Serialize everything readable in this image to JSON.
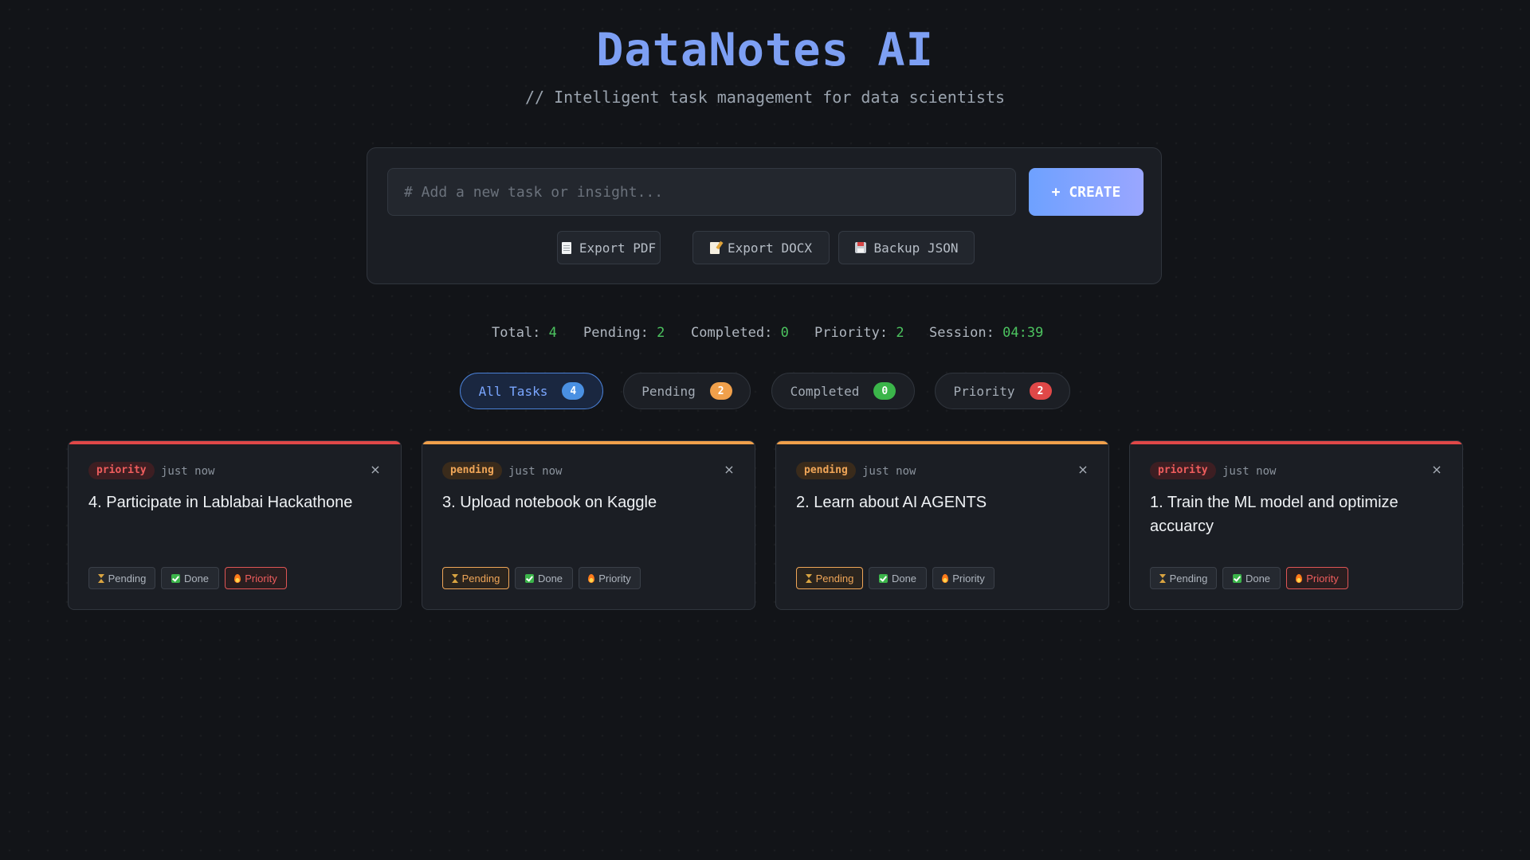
{
  "header": {
    "title": "DataNotes AI",
    "subtitle": "// Intelligent task management for data scientists"
  },
  "composer": {
    "input_value": "",
    "input_placeholder": "# Add a new task or insight...",
    "create_label": "+ CREATE",
    "export_pdf_label": "Export PDF",
    "export_docx_label": "Export DOCX",
    "backup_json_label": "Backup JSON"
  },
  "stats": {
    "total_label": "Total:",
    "total_value": "4",
    "pending_label": "Pending:",
    "pending_value": "2",
    "completed_label": "Completed:",
    "completed_value": "0",
    "priority_label": "Priority:",
    "priority_value": "2",
    "session_label": "Session:",
    "session_value": "04:39"
  },
  "filters": [
    {
      "label": "All Tasks",
      "count": "4",
      "active": true,
      "badge_color": "#4a90e2"
    },
    {
      "label": "Pending",
      "count": "2",
      "active": false,
      "badge_color": "#f0a04b"
    },
    {
      "label": "Completed",
      "count": "0",
      "active": false,
      "badge_color": "#3bb54a"
    },
    {
      "label": "Priority",
      "count": "2",
      "active": false,
      "badge_color": "#e04848"
    }
  ],
  "tasks": [
    {
      "status": "priority",
      "time": "just now",
      "text": "4. Participate in Lablabai Hackathone",
      "close": "×",
      "actions": {
        "pending": "Pending",
        "done": "Done",
        "priority": "Priority"
      },
      "accent": "#e04848"
    },
    {
      "status": "pending",
      "time": "just now",
      "text": "3. Upload notebook on Kaggle",
      "close": "×",
      "actions": {
        "pending": "Pending",
        "done": "Done",
        "priority": "Priority"
      },
      "accent": "#f0a04b"
    },
    {
      "status": "pending",
      "time": "just now",
      "text": "2. Learn about AI AGENTS",
      "close": "×",
      "actions": {
        "pending": "Pending",
        "done": "Done",
        "priority": "Priority"
      },
      "accent": "#f0a04b"
    },
    {
      "status": "priority",
      "time": "just now",
      "text": "1. Train the ML model and optimize accuarcy",
      "close": "×",
      "actions": {
        "pending": "Pending",
        "done": "Done",
        "priority": "Priority"
      },
      "accent": "#e04848"
    }
  ],
  "colors": {
    "background": "#121418",
    "title": "#7d9ff3",
    "stat_value": "#4cc35f",
    "priority": "#e04848",
    "pending": "#f0a04b",
    "done": "#3bb54a",
    "accent": "#6ea1ff"
  }
}
